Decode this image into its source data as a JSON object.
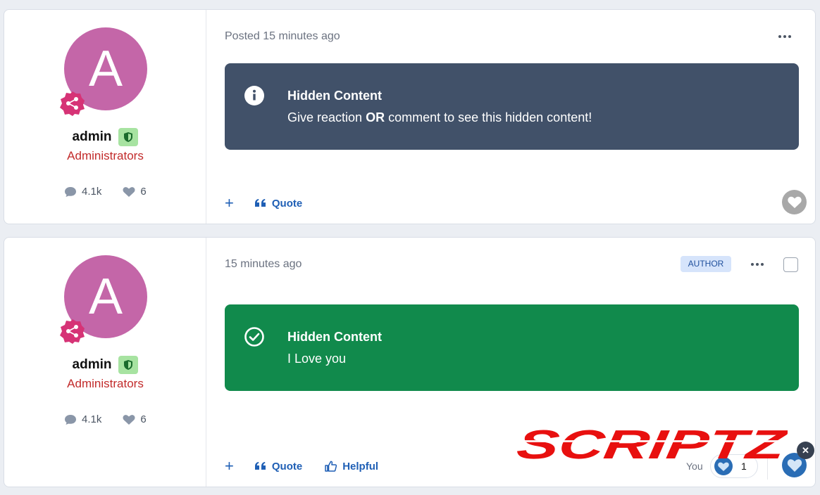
{
  "posts": [
    {
      "author": {
        "avatar_letter": "A",
        "name": "admin",
        "group": "Administrators",
        "comments": "4.1k",
        "likes": "6"
      },
      "time": "Posted 15 minutes ago",
      "hidden": {
        "title": "Hidden Content",
        "text_before": "Give reaction ",
        "text_bold": "OR",
        "text_after": " comment to see this hidden content!",
        "icon": "info-icon",
        "color": "#415169"
      },
      "actions": {
        "quote": "Quote"
      }
    },
    {
      "author": {
        "avatar_letter": "A",
        "name": "admin",
        "group": "Administrators",
        "comments": "4.1k",
        "likes": "6"
      },
      "time": "15 minutes ago",
      "author_tag": "AUTHOR",
      "hidden": {
        "title": "Hidden Content",
        "text": "I Love you",
        "icon": "check-circle-icon",
        "color": "#118a4c"
      },
      "actions": {
        "quote": "Quote",
        "helpful": "Helpful"
      },
      "reaction": {
        "you_label": "You",
        "count": "1"
      }
    }
  ],
  "watermark": {
    "text": "SCRIPTZ",
    "color": "#e8100f"
  },
  "colors": {
    "avatar": "#c466a8",
    "group": "#c22b2b",
    "link": "#1f5fb5"
  }
}
